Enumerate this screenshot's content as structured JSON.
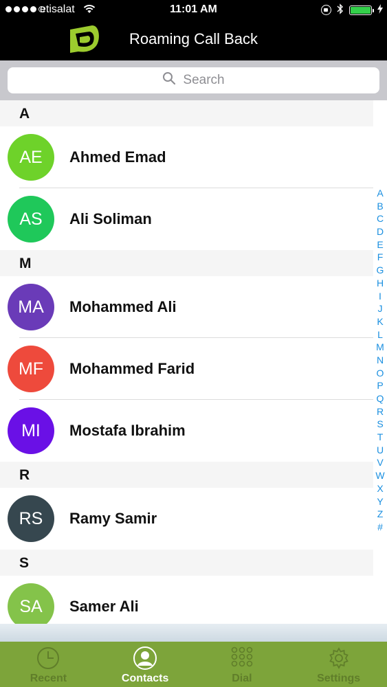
{
  "status_bar": {
    "carrier": "etisalat",
    "time": "11:01 AM",
    "battery_color": "#33d04a"
  },
  "header": {
    "title": "Roaming Call Back",
    "logo_icon": "etisalat-logo"
  },
  "search": {
    "placeholder": "Search",
    "icon": "search-icon"
  },
  "sections": [
    {
      "letter": "A",
      "contacts": [
        {
          "initials": "AE",
          "name": "Ahmed Emad",
          "color": "#6ed22a"
        },
        {
          "initials": "AS",
          "name": "Ali Soliman",
          "color": "#1fc85a"
        }
      ]
    },
    {
      "letter": "M",
      "contacts": [
        {
          "initials": "MA",
          "name": "Mohammed Ali",
          "color": "#6a3bb8"
        },
        {
          "initials": "MF",
          "name": "Mohammed Farid",
          "color": "#ee4a3c"
        },
        {
          "initials": "MI",
          "name": "Mostafa Ibrahim",
          "color": "#6a10e6"
        }
      ]
    },
    {
      "letter": "R",
      "contacts": [
        {
          "initials": "RS",
          "name": "Ramy Samir",
          "color": "#36474f"
        }
      ]
    },
    {
      "letter": "S",
      "contacts": [
        {
          "initials": "SA",
          "name": "Samer Ali",
          "color": "#84c34a"
        }
      ]
    }
  ],
  "index_letters": [
    "A",
    "B",
    "C",
    "D",
    "E",
    "F",
    "G",
    "H",
    "I",
    "J",
    "K",
    "L",
    "M",
    "N",
    "O",
    "P",
    "Q",
    "R",
    "S",
    "T",
    "U",
    "V",
    "W",
    "X",
    "Y",
    "Z",
    "#"
  ],
  "tabs": [
    {
      "label": "Recent",
      "icon": "clock-icon",
      "active": false
    },
    {
      "label": "Contacts",
      "icon": "contacts-icon",
      "active": true
    },
    {
      "label": "Dial",
      "icon": "dialpad-icon",
      "active": false
    },
    {
      "label": "Settings",
      "icon": "gear-icon",
      "active": false
    }
  ],
  "colors": {
    "tabbar_bg": "#7da43a",
    "tab_inactive": "#607e2a",
    "tab_active": "#ffffff",
    "index_link": "#1a8fe0"
  }
}
